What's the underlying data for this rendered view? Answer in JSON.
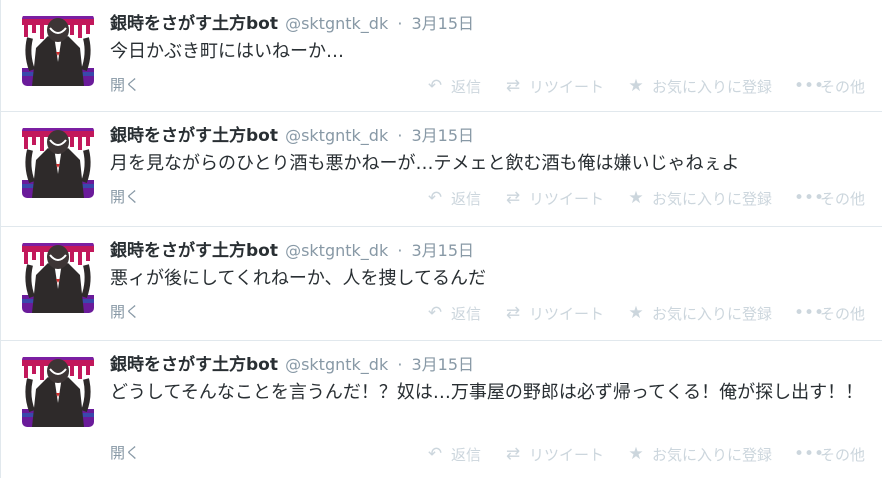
{
  "tweets": [
    {
      "fullname": "銀時をさがす土方bot",
      "username": "@sktgntk_dk",
      "time": "3月15日",
      "text": "今日かぶき町にはいねーか…",
      "expand": "開く"
    },
    {
      "fullname": "銀時をさがす土方bot",
      "username": "@sktgntk_dk",
      "time": "3月15日",
      "text": "月を見ながらのひとり酒も悪かねーが…テメェと飲む酒も俺は嫌いじゃねぇよ",
      "expand": "開く"
    },
    {
      "fullname": "銀時をさがす土方bot",
      "username": "@sktgntk_dk",
      "time": "3月15日",
      "text": "悪ィが後にしてくれねーか、人を捜してるんだ",
      "expand": "開く"
    },
    {
      "fullname": "銀時をさがす土方bot",
      "username": "@sktgntk_dk",
      "time": "3月15日",
      "text": "どうしてそんなことを言うんだ！？奴は…万事屋の野郎は必ず帰ってくる！俺が探し出す！！",
      "expand": "開く"
    }
  ],
  "actions": {
    "reply": "返信",
    "retweet": "リツイート",
    "favorite": "お気に入りに登録",
    "more": "その他"
  },
  "separator": "·",
  "icons": {
    "reply": "reply-icon",
    "retweet": "retweet-icon",
    "favorite": "star-icon",
    "more": "more-dots-icon"
  },
  "colors": {
    "text": "#292f33",
    "muted": "#8899a6",
    "action": "#ccd6dd",
    "divider": "#e1e8ed"
  }
}
